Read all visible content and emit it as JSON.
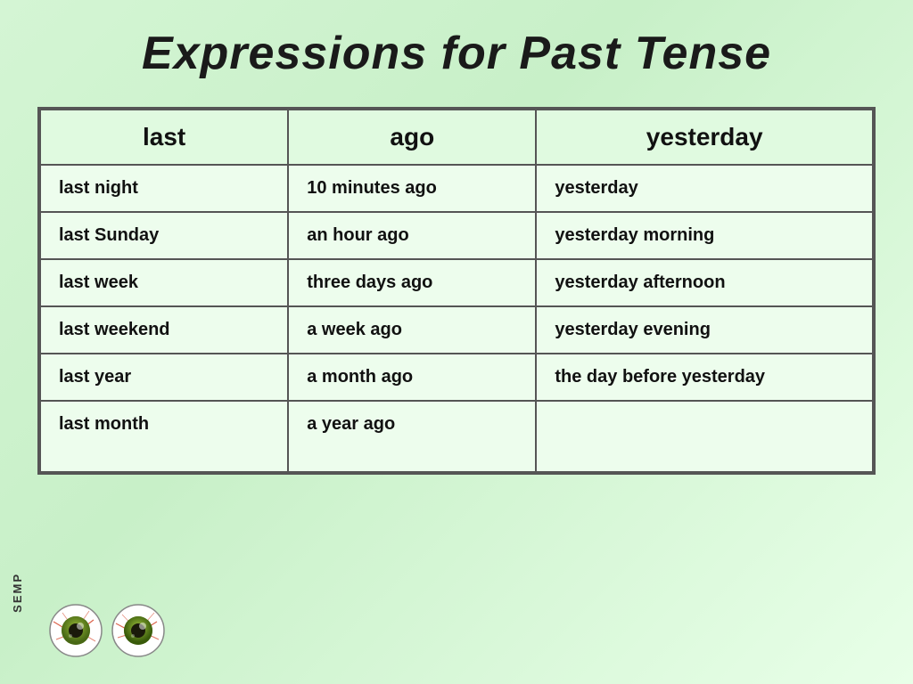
{
  "page": {
    "title": "Expressions for Past Tense",
    "background_color": "#ccf2cc"
  },
  "table": {
    "headers": [
      "last",
      "ago",
      "yesterday"
    ],
    "rows": [
      [
        "last night",
        "10 minutes ago",
        "yesterday"
      ],
      [
        "last Sunday",
        "an hour ago",
        "yesterday morning"
      ],
      [
        "last week",
        "three days ago",
        "yesterday afternoon"
      ],
      [
        "last weekend",
        "a week ago",
        "yesterday evening"
      ],
      [
        "last year",
        "a month ago",
        "the day before yesterday"
      ],
      [
        "last month",
        "a year ago",
        ""
      ]
    ]
  },
  "footer": {
    "semp_label": "SEMP"
  }
}
